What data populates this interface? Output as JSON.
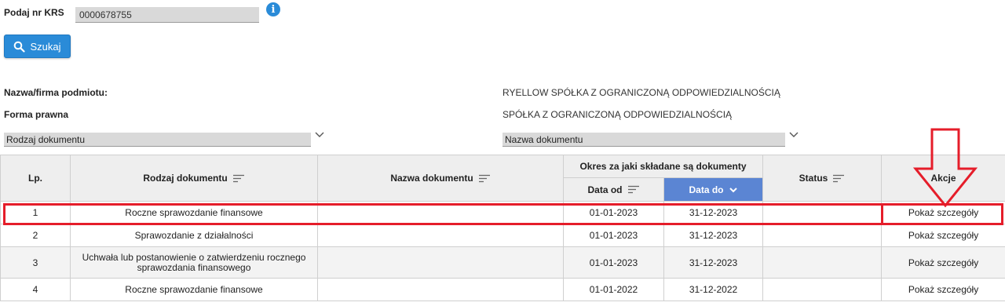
{
  "search": {
    "krs_label": "Podaj nr KRS",
    "krs_value": "0000678755",
    "button_label": "Szukaj"
  },
  "entity": {
    "name_label": "Nazwa/firma podmiotu:",
    "name_value": "RYELLOW SPÓŁKA Z OGRANICZONĄ ODPOWIEDZIALNOŚCIĄ",
    "form_label": "Forma prawna",
    "form_value": "SPÓŁKA Z OGRANICZONĄ ODPOWIEDZIALNOŚCIĄ"
  },
  "filters": {
    "doc_type_value": "Rodzaj dokumentu",
    "doc_name_value": "Nazwa dokumentu"
  },
  "table": {
    "headers": {
      "lp": "Lp.",
      "doc_type": "Rodzaj dokumentu",
      "doc_name": "Nazwa dokumentu",
      "period": "Okres za jaki składane są dokumenty",
      "date_from": "Data od",
      "date_to": "Data do",
      "status": "Status",
      "actions": "Akcje"
    },
    "rows": [
      {
        "lp": "1",
        "doc_type": "Roczne sprawozdanie finansowe",
        "doc_name": "",
        "date_from": "01-01-2023",
        "date_to": "31-12-2023",
        "status": "",
        "action": "Pokaż szczegóły"
      },
      {
        "lp": "2",
        "doc_type": "Sprawozdanie z działalności",
        "doc_name": "",
        "date_from": "01-01-2023",
        "date_to": "31-12-2023",
        "status": "",
        "action": "Pokaż szczegóły"
      },
      {
        "lp": "3",
        "doc_type": "Uchwała lub postanowienie o zatwierdzeniu rocznego sprawozdania finansowego",
        "doc_name": "",
        "date_from": "01-01-2023",
        "date_to": "31-12-2023",
        "status": "",
        "action": "Pokaż szczegóły"
      },
      {
        "lp": "4",
        "doc_type": "Roczne sprawozdanie finansowe",
        "doc_name": "",
        "date_from": "01-01-2022",
        "date_to": "31-12-2022",
        "status": "",
        "action": "Pokaż szczegóły"
      }
    ]
  },
  "colors": {
    "accent": "#2a8bd8",
    "sorted_header": "#5b85d3",
    "annotation": "#e51d2a"
  },
  "icons": {
    "info": "info-icon",
    "search": "search-icon",
    "sort": "sort-lines-icon",
    "chevron": "chevron-down-icon",
    "annotation_arrow": "down-arrow-icon"
  }
}
